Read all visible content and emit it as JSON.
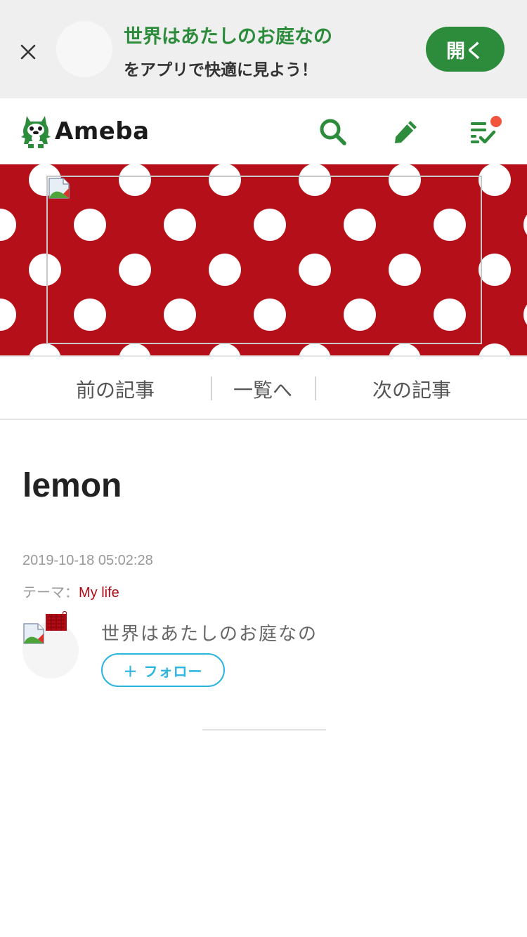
{
  "app_banner": {
    "blog_name": "世界はあたしのお庭なの",
    "subtitle": "をアプリで快適に見よう！",
    "open_label": "開く"
  },
  "header": {
    "logo_text": "Ameba",
    "icons": [
      "search-icon",
      "edit-pencil-icon",
      "checklist-icon"
    ],
    "has_notification": true
  },
  "colors": {
    "brand_green": "#2d8c3c",
    "header_red": "#b50f19",
    "theme_link_red": "#b10a14",
    "follow_blue": "#2cb5e0",
    "notification_red": "#f2553d"
  },
  "article_nav": {
    "prev": "前の記事",
    "list": "一覧へ",
    "next": "次の記事"
  },
  "entry": {
    "title": "lemon",
    "date": "2019-10-18 05:02:28",
    "theme_label": "テーマ：",
    "theme_value": "My life"
  },
  "author": {
    "name": "世界はあたしのお庭なの",
    "follow_label": "＋ フォロー"
  }
}
